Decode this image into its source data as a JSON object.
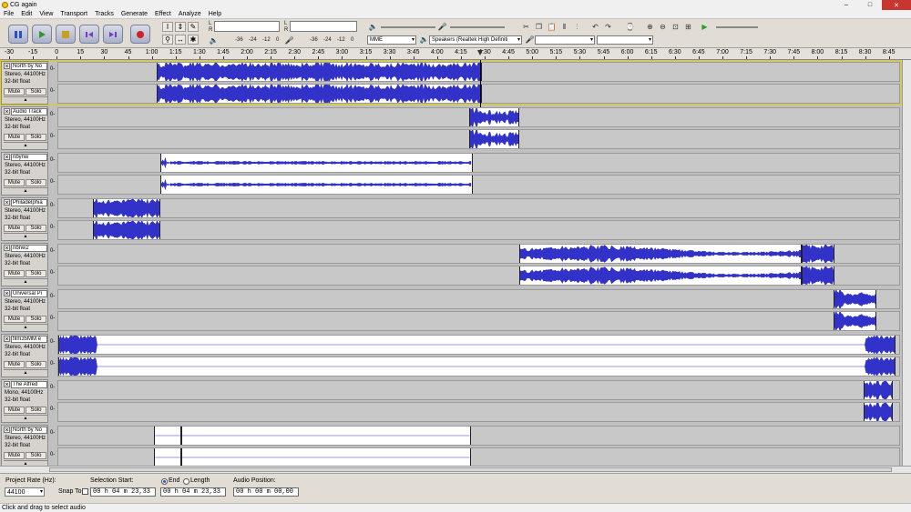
{
  "window": {
    "title": "CG again",
    "minimize": "–",
    "maximize": "□",
    "close": "✕"
  },
  "menu": [
    "File",
    "Edit",
    "View",
    "Transport",
    "Tracks",
    "Generate",
    "Effect",
    "Analyze",
    "Help"
  ],
  "transport": {
    "buttons": [
      {
        "name": "pause-button",
        "icon": "pause-icon"
      },
      {
        "name": "play-button",
        "icon": "play-icon"
      },
      {
        "name": "stop-button",
        "icon": "stop-icon"
      },
      {
        "name": "skip-start-button",
        "icon": "skip-start-icon"
      },
      {
        "name": "skip-end-button",
        "icon": "skip-end-icon"
      },
      {
        "name": "record-button",
        "icon": "record-icon"
      }
    ]
  },
  "meters": {
    "play_channels": [
      "L",
      "R"
    ],
    "rec_channels": [
      "L",
      "R"
    ],
    "play_scale": [
      "-36",
      "-24",
      "-12",
      "0"
    ],
    "rec_scale": [
      "-36",
      "-24",
      "-12",
      "0"
    ]
  },
  "devices": {
    "host": "MME",
    "output": "Speakers (Realtek High Definiti",
    "input": "",
    "input_channels": ""
  },
  "colors": {
    "waveform": "#3232c8",
    "clip_bg": "#ffffff",
    "track_bg": "#c8c8c8",
    "playhead": "#ff0000"
  },
  "timeline": {
    "labels": [
      "-30",
      "-15",
      "0",
      "15",
      "30",
      "45",
      "1:00",
      "1:15",
      "1:30",
      "1:45",
      "2:00",
      "2:15",
      "2:30",
      "2:45",
      "3:00",
      "3:15",
      "3:30",
      "3:45",
      "4:00",
      "4:15",
      "4:30",
      "4:45",
      "5:00",
      "5:15",
      "5:30",
      "5:45",
      "6:00",
      "6:15",
      "6:30",
      "6:45",
      "7:00",
      "7:15",
      "7:30",
      "7:45",
      "8:00",
      "8:15",
      "8:30",
      "8:45"
    ]
  },
  "tracks": [
    {
      "name": "North by No",
      "rate": "Stereo, 44100Hz",
      "format": "32-bit float",
      "mute": "Mute",
      "solo": "Solo",
      "selected": true,
      "clips": [
        {
          "start": 0.1167,
          "end": 0.5025,
          "kind": "dense"
        }
      ]
    },
    {
      "name": "Audio Track",
      "rate": "Stereo, 44100Hz",
      "format": "32-bit float",
      "mute": "Mute",
      "solo": "Solo",
      "selected": false,
      "clips": [
        {
          "start": 0.4876,
          "end": 0.5472,
          "kind": "burst"
        }
      ]
    },
    {
      "name": "nbynw",
      "rate": "Stereo, 44100Hz",
      "format": "32-bit float",
      "mute": "Mute",
      "solo": "Solo",
      "selected": false,
      "clips": [
        {
          "start": 0.1216,
          "end": 0.4915,
          "kind": "thin"
        }
      ]
    },
    {
      "name": "Philadelphia",
      "rate": "Stereo, 44100Hz",
      "format": "32-bit float",
      "mute": "Mute",
      "solo": "Solo",
      "selected": false,
      "clips": [
        {
          "start": 0.0412,
          "end": 0.1216,
          "kind": "dense"
        }
      ]
    },
    {
      "name": "nbnw2",
      "rate": "Stereo, 44100Hz",
      "format": "32-bit float",
      "mute": "Mute",
      "solo": "Solo",
      "selected": false,
      "clips": [
        {
          "start": 0.5472,
          "end": 0.8824,
          "kind": "long"
        },
        {
          "start": 0.8824,
          "end": 0.9214,
          "kind": "dense"
        }
      ]
    },
    {
      "name": "Universal Pi",
      "rate": "Stereo, 44100Hz",
      "format": "32-bit float",
      "mute": "Mute",
      "solo": "Solo",
      "selected": false,
      "clips": [
        {
          "start": 0.9203,
          "end": 0.9711,
          "kind": "burst"
        }
      ]
    },
    {
      "name": "film35MM e",
      "rate": "Stereo, 44100Hz",
      "format": "32-bit float",
      "mute": "Mute",
      "solo": "Solo",
      "selected": false,
      "clips": [
        {
          "start": 0.0,
          "end": 0.9935,
          "kind": "ends"
        }
      ]
    },
    {
      "name": "The Alfred",
      "rate": "Mono, 44100Hz",
      "format": "32-bit float",
      "mute": "Mute",
      "solo": "Solo",
      "selected": false,
      "clips": [
        {
          "start": 0.9557,
          "end": 0.9903,
          "kind": "dense"
        }
      ]
    },
    {
      "name": "North by No",
      "rate": "Stereo, 44100Hz",
      "format": "32-bit float",
      "mute": "Mute",
      "solo": "Solo",
      "selected": false,
      "clips": [
        {
          "start": 0.1135,
          "end": 0.1459,
          "kind": "silent"
        },
        {
          "start": 0.1459,
          "end": 0.4893,
          "kind": "silent"
        }
      ]
    }
  ],
  "bottom": {
    "project_rate_label": "Project Rate (Hz):",
    "project_rate": "44100",
    "snap_label": "Snap To",
    "selection_start_label": "Selection Start:",
    "selection_start": "00 h 04 m 23,33 s",
    "end_label": "End",
    "length_label": "Length",
    "selection_end": "00 h 04 m 23,33 s",
    "audio_position_label": "Audio Position:",
    "audio_position": "00 h 00 m 00,00 s"
  },
  "status": "Click and drag to select audio"
}
